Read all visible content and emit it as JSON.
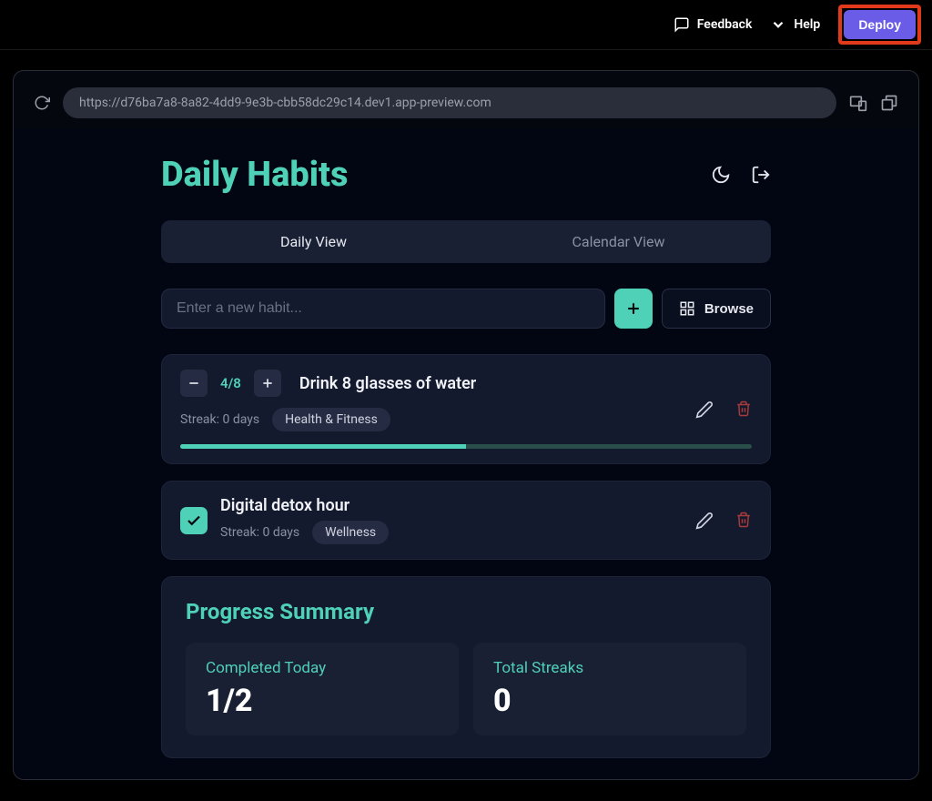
{
  "topbar": {
    "feedback": "Feedback",
    "help": "Help",
    "deploy": "Deploy"
  },
  "preview": {
    "url": "https://d76ba7a8-8a82-4dd9-9e3b-cbb58dc29c14.dev1.app-preview.com"
  },
  "app": {
    "title": "Daily Habits",
    "tabs": {
      "daily": "Daily View",
      "calendar": "Calendar View"
    },
    "input": {
      "placeholder": "Enter a new habit..."
    },
    "browse": "Browse"
  },
  "habits": [
    {
      "name": "Drink 8 glasses of water",
      "counter": "4/8",
      "streak": "Streak: 0 days",
      "category": "Health & Fitness",
      "progress_pct": 50
    },
    {
      "name": "Digital detox hour",
      "streak": "Streak: 0 days",
      "category": "Wellness",
      "done": true
    }
  ],
  "summary": {
    "title": "Progress Summary",
    "completed_label": "Completed Today",
    "completed_value": "1/2",
    "streaks_label": "Total Streaks",
    "streaks_value": "0"
  }
}
